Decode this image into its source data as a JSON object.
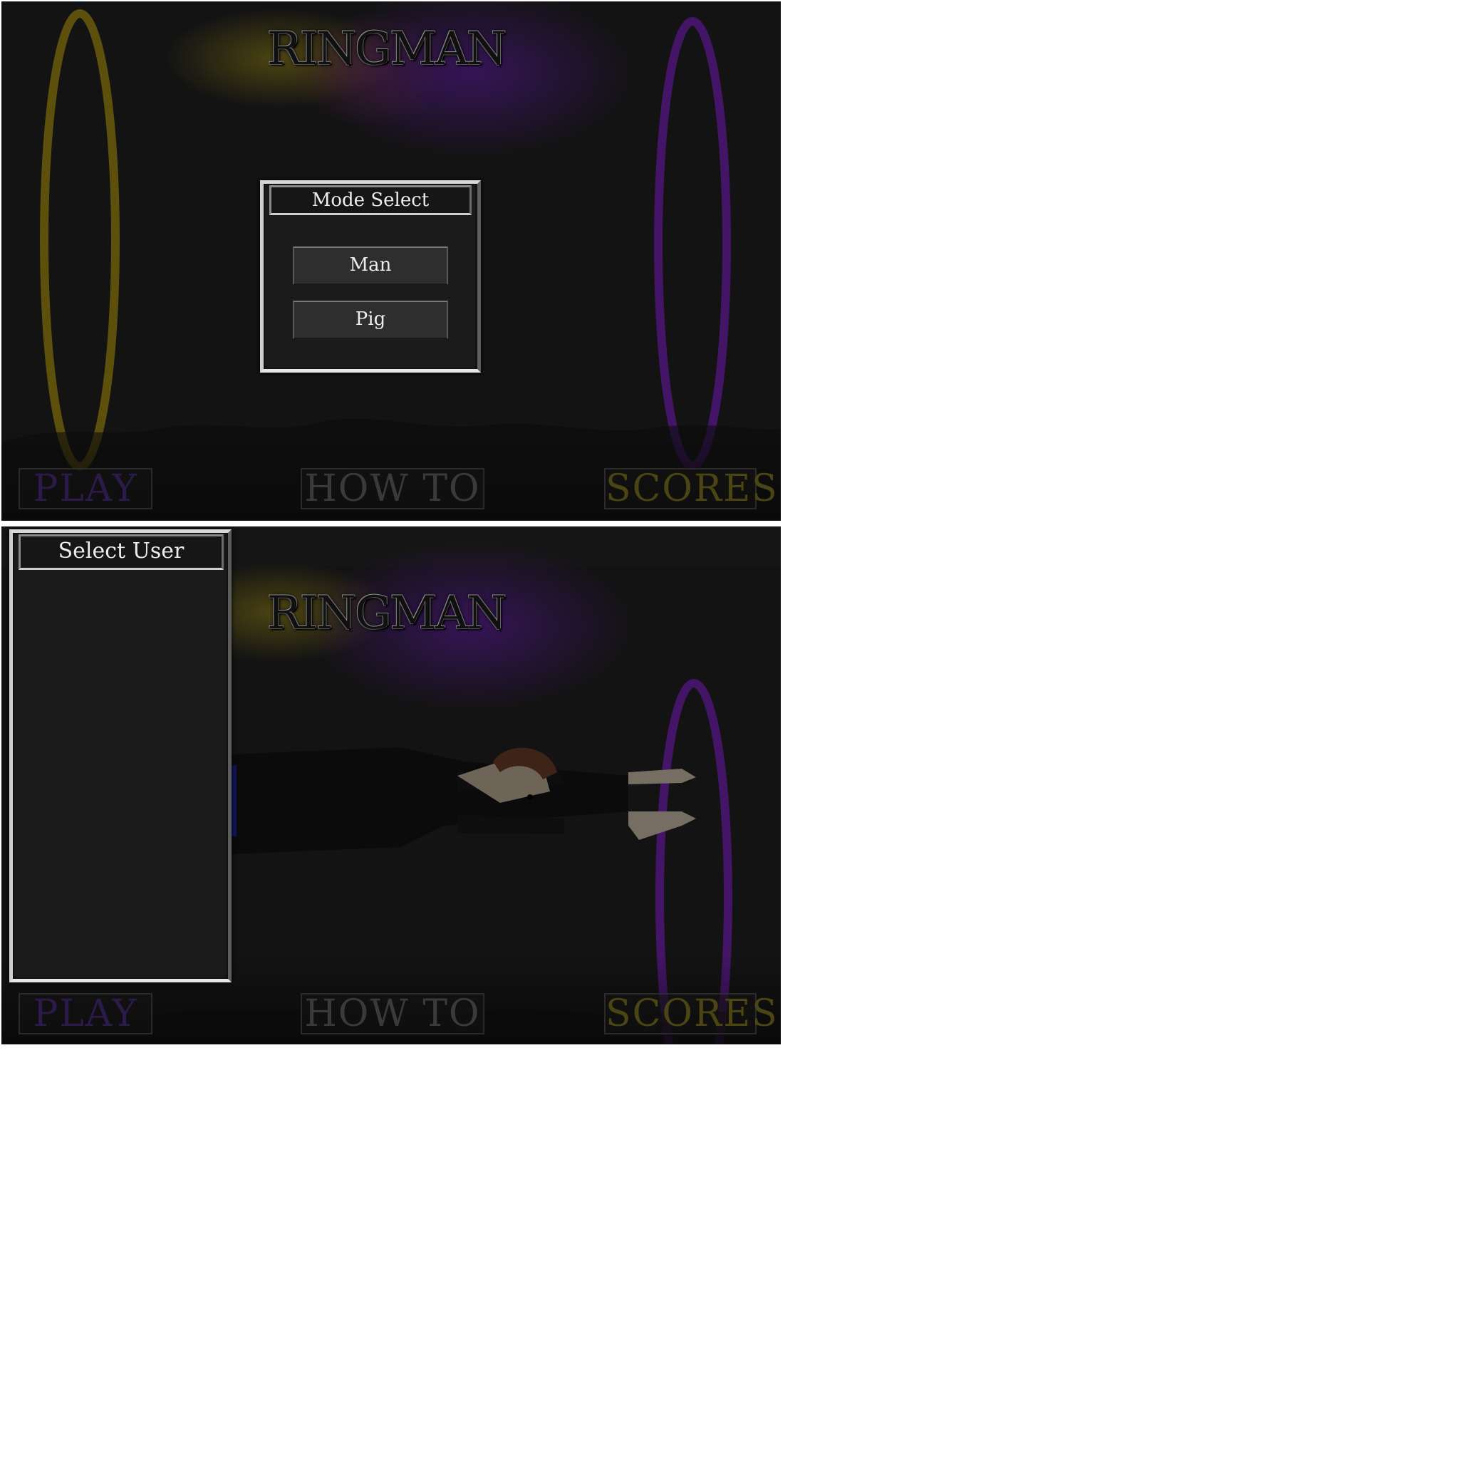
{
  "screens": [
    {
      "title": "RINGMAN",
      "nav": {
        "play": "PLAY",
        "how_to": "HOW TO",
        "scores": "SCORES"
      },
      "mode_select": {
        "header": "Mode Select",
        "options": [
          "Man",
          "Pig"
        ]
      }
    },
    {
      "title": "RINGMAN",
      "nav": {
        "play": "PLAY",
        "how_to": "HOW TO",
        "scores": "SCORES"
      },
      "user_select": {
        "header": "Select User",
        "users": []
      }
    }
  ],
  "colors": {
    "background": "#131313",
    "ring_left": "#6b5a0c",
    "ring_right": "#4a1670",
    "play_text": "#2c1a4a",
    "how_to_text": "#3a3a3a",
    "scores_text": "#4a4512",
    "panel_border": "#c8c8c8"
  },
  "icons": [
    "yellow-ring",
    "purple-ring",
    "diving-ringman-character"
  ]
}
